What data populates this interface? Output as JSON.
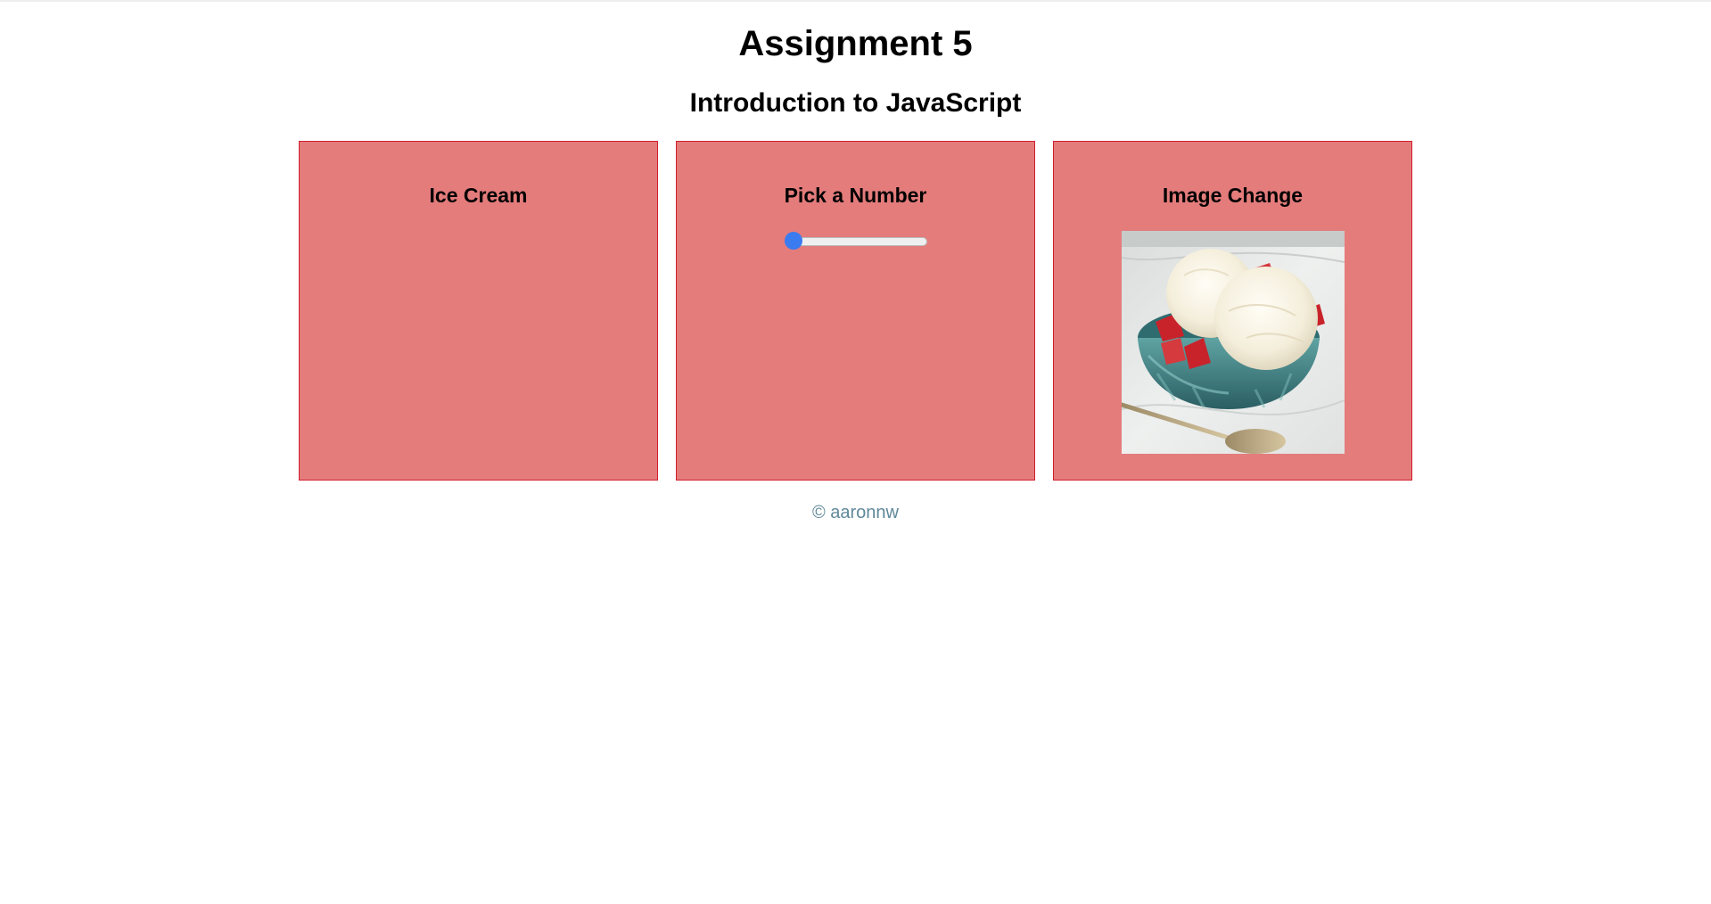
{
  "header": {
    "title": "Assignment 5",
    "subtitle": "Introduction to JavaScript"
  },
  "cards": [
    {
      "title": "Ice Cream"
    },
    {
      "title": "Pick a Number",
      "slider": {
        "min": 0,
        "max": 100,
        "value": 0
      }
    },
    {
      "title": "Image Change",
      "image": "ice-cream-bowl-photo"
    }
  ],
  "footer": {
    "text": "© aaronnw"
  },
  "colors": {
    "card_background": "#e47c7c",
    "card_border": "#d11f2c",
    "slider_accent": "#3b7bf0",
    "footer_text": "#5f8899"
  }
}
